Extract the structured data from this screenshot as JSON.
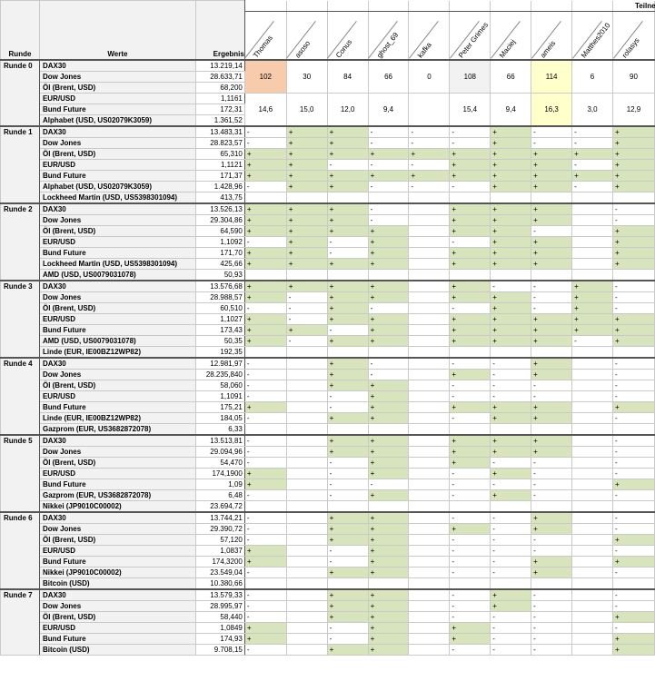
{
  "header": {
    "runde_label": "Runde",
    "werte_label": "Werte",
    "ergebnis_label": "Ergebnis",
    "teilnehmer_label": "Teilne",
    "participants": [
      "Thomas",
      "asoso",
      "Conus",
      "ghost_69",
      "kafka",
      "Peter Grimes",
      "Maciej",
      "ameis",
      "Matthes2010",
      "rolasys"
    ]
  },
  "runde0": {
    "label": "Runde 0",
    "rows": [
      {
        "name": "DAX30",
        "value": "13.219,14"
      },
      {
        "name": "Dow Jones",
        "value": "28.633,71"
      },
      {
        "name": "Öl (Brent, USD)",
        "value": "68,200"
      },
      {
        "name": "EUR/USD",
        "value": "1,1161"
      },
      {
        "name": "Bund Future",
        "value": "172,31"
      },
      {
        "name": "Alphabet (USD, US02079K3059)",
        "value": "1.361,52"
      }
    ],
    "scores": [
      "102",
      "30",
      "84",
      "66",
      "0",
      "108",
      "66",
      "114",
      "6",
      "90"
    ],
    "averages": [
      "14,6",
      "15,0",
      "12,0",
      "9,4",
      "",
      "15,4",
      "9,4",
      "16,3",
      "3,0",
      "12,9"
    ]
  },
  "rounds": [
    {
      "label": "Runde 1",
      "rows": [
        {
          "name": "DAX30",
          "value": "13.483,31",
          "cells": [
            "-",
            "+",
            "+",
            "-",
            "-",
            "-",
            "+",
            "-",
            "-",
            "+"
          ]
        },
        {
          "name": "Dow Jones",
          "value": "28.823,57",
          "cells": [
            "-",
            "+",
            "+",
            "-",
            "-",
            "-",
            "+",
            "-",
            "-",
            "+"
          ]
        },
        {
          "name": "Öl (Brent, USD)",
          "value": "65,310",
          "cells": [
            "+",
            "+",
            "+",
            "+",
            "+",
            "+",
            "+",
            "+",
            "+",
            "+"
          ]
        },
        {
          "name": "EUR/USD",
          "value": "1,1121",
          "cells": [
            "+",
            "+",
            "-",
            "-",
            "-",
            "+",
            "+",
            "+",
            "-",
            "+"
          ]
        },
        {
          "name": "Bund Future",
          "value": "171,37",
          "cells": [
            "+",
            "+",
            "+",
            "+",
            "+",
            "+",
            "+",
            "+",
            "+",
            "+"
          ]
        },
        {
          "name": "Alphabet (USD, US02079K3059)",
          "value": "1.428,96",
          "cells": [
            "-",
            "+",
            "+",
            "-",
            "-",
            "-",
            "+",
            "+",
            "-",
            "+"
          ]
        },
        {
          "name": "Lockheed Martin (USD, US5398301094)",
          "value": "413,75",
          "cells": [
            "",
            "",
            "",
            "",
            "",
            "",
            "",
            "",
            "",
            ""
          ]
        }
      ]
    },
    {
      "label": "Runde 2",
      "rows": [
        {
          "name": "DAX30",
          "value": "13.526,13",
          "cells": [
            "+",
            "+",
            "+",
            "-",
            "",
            "+",
            "+",
            "+",
            "",
            "-"
          ]
        },
        {
          "name": "Dow Jones",
          "value": "29.304,86",
          "cells": [
            "+",
            "+",
            "+",
            "-",
            "",
            "+",
            "+",
            "+",
            "",
            "-"
          ]
        },
        {
          "name": "Öl (Brent, USD)",
          "value": "64,590",
          "cells": [
            "+",
            "+",
            "+",
            "+",
            "",
            "+",
            "+",
            "-",
            "",
            "+"
          ]
        },
        {
          "name": "EUR/USD",
          "value": "1,1092",
          "cells": [
            "-",
            "+",
            "-",
            "+",
            "",
            "-",
            "+",
            "+",
            "",
            "+"
          ]
        },
        {
          "name": "Bund Future",
          "value": "171,70",
          "cells": [
            "+",
            "+",
            "-",
            "+",
            "",
            "+",
            "+",
            "+",
            "",
            "+"
          ]
        },
        {
          "name": "Lockheed Martin (USD, US5398301094)",
          "value": "425,66",
          "cells": [
            "+",
            "+",
            "+",
            "+",
            "",
            "+",
            "+",
            "+",
            "",
            "+"
          ]
        },
        {
          "name": "AMD (USD, US0079031078)",
          "value": "50,93",
          "cells": [
            "",
            "",
            "",
            "",
            "",
            "",
            "",
            "",
            "",
            ""
          ]
        }
      ]
    },
    {
      "label": "Runde 3",
      "rows": [
        {
          "name": "DAX30",
          "value": "13.576,68",
          "cells": [
            "+",
            "+",
            "+",
            "+",
            "",
            "+",
            "-",
            "-",
            "+",
            "-"
          ]
        },
        {
          "name": "Dow Jones",
          "value": "28.988,57",
          "cells": [
            "+",
            "-",
            "+",
            "+",
            "",
            "+",
            "+",
            "-",
            "+",
            "-"
          ]
        },
        {
          "name": "Öl (Brent, USD)",
          "value": "60,510",
          "cells": [
            "-",
            "-",
            "+",
            "-",
            "",
            "-",
            "+",
            "-",
            "+",
            "-"
          ]
        },
        {
          "name": "EUR/USD",
          "value": "1,1027",
          "cells": [
            "+",
            "-",
            "+",
            "+",
            "",
            "+",
            "+",
            "+",
            "+",
            "+"
          ]
        },
        {
          "name": "Bund Future",
          "value": "173,43",
          "cells": [
            "+",
            "+",
            "-",
            "+",
            "",
            "+",
            "+",
            "+",
            "+",
            "+"
          ]
        },
        {
          "name": "AMD (USD, US0079031078)",
          "value": "50,35",
          "cells": [
            "+",
            "-",
            "+",
            "+",
            "",
            "+",
            "+",
            "+",
            "-",
            "+"
          ]
        },
        {
          "name": "Linde (EUR, IE00BZ12WP82)",
          "value": "192,35",
          "cells": [
            "",
            "",
            "",
            "",
            "",
            "",
            "",
            "",
            "",
            ""
          ]
        }
      ]
    },
    {
      "label": "Runde 4",
      "rows": [
        {
          "name": "DAX30",
          "value": "12.981,97",
          "cells": [
            "-",
            "",
            "+",
            "-",
            "",
            "-",
            "-",
            "+",
            "",
            "-"
          ]
        },
        {
          "name": "Dow Jones",
          "value": "28.235,840",
          "cells": [
            "-",
            "",
            "+",
            "-",
            "",
            "+",
            "-",
            "+",
            "",
            "-"
          ]
        },
        {
          "name": "Öl (Brent, USD)",
          "value": "58,060",
          "cells": [
            "-",
            "",
            "+",
            "+",
            "",
            "-",
            "-",
            "-",
            "",
            "-"
          ]
        },
        {
          "name": "EUR/USD",
          "value": "1,1091",
          "cells": [
            "-",
            "",
            "-",
            "+",
            "",
            "-",
            "-",
            "-",
            "",
            "-"
          ]
        },
        {
          "name": "Bund Future",
          "value": "175,21",
          "cells": [
            "+",
            "",
            "-",
            "+",
            "",
            "+",
            "+",
            "+",
            "",
            "+"
          ]
        },
        {
          "name": "Linde (EUR, IE00BZ12WP82)",
          "value": "184,05",
          "cells": [
            "-",
            "",
            "+",
            "+",
            "",
            "-",
            "+",
            "+",
            "",
            "-"
          ]
        },
        {
          "name": "Gazprom (EUR, US3682872078)",
          "value": "6,33",
          "cells": [
            "",
            "",
            "",
            "",
            "",
            "",
            "",
            "",
            "",
            ""
          ]
        }
      ]
    },
    {
      "label": "Runde 5",
      "rows": [
        {
          "name": "DAX30",
          "value": "13.513,81",
          "cells": [
            "-",
            "",
            "+",
            "+",
            "",
            "+",
            "+",
            "+",
            "",
            "-"
          ]
        },
        {
          "name": "Dow Jones",
          "value": "29.094,96",
          "cells": [
            "-",
            "",
            "+",
            "+",
            "",
            "+",
            "+",
            "+",
            "",
            "-"
          ]
        },
        {
          "name": "Öl (Brent, USD)",
          "value": "54,470",
          "cells": [
            "-",
            "",
            "-",
            "+",
            "",
            "+",
            "-",
            "-",
            "",
            "-"
          ]
        },
        {
          "name": "EUR/USD",
          "value": "174,1900",
          "cells": [
            "+",
            "",
            "-",
            "+",
            "",
            "-",
            "+",
            "-",
            "",
            "-"
          ]
        },
        {
          "name": "Bund Future",
          "value": "1,09",
          "cells": [
            "+",
            "",
            "-",
            "-",
            "",
            "-",
            "-",
            "-",
            "",
            "+"
          ]
        },
        {
          "name": "Gazprom (EUR, US3682872078)",
          "value": "6,48",
          "cells": [
            "-",
            "",
            "-",
            "+",
            "",
            "-",
            "+",
            "-",
            "",
            "-"
          ]
        },
        {
          "name": "Nikkei (JP9010C00002)",
          "value": "23.694,72",
          "cells": [
            "",
            "",
            "",
            "",
            "",
            "",
            "",
            "",
            "",
            ""
          ]
        }
      ]
    },
    {
      "label": "Runde 6",
      "rows": [
        {
          "name": "DAX30",
          "value": "13.744,21",
          "cells": [
            "-",
            "",
            "+",
            "+",
            "",
            "-",
            "-",
            "+",
            "",
            "-"
          ]
        },
        {
          "name": "Dow Jones",
          "value": "29.390,72",
          "cells": [
            "-",
            "",
            "+",
            "+",
            "",
            "+",
            "-",
            "+",
            "",
            "-"
          ]
        },
        {
          "name": "Öl (Brent, USD)",
          "value": "57,120",
          "cells": [
            "-",
            "",
            "+",
            "+",
            "",
            "-",
            "-",
            "-",
            "",
            "+"
          ]
        },
        {
          "name": "EUR/USD",
          "value": "1,0837",
          "cells": [
            "+",
            "",
            "-",
            "+",
            "",
            "-",
            "-",
            "-",
            "",
            "-"
          ]
        },
        {
          "name": "Bund Future",
          "value": "174,3200",
          "cells": [
            "+",
            "",
            "-",
            "+",
            "",
            "-",
            "-",
            "+",
            "",
            "+"
          ]
        },
        {
          "name": "Nikkei (JP9010C00002)",
          "value": "23.549,04",
          "cells": [
            "-",
            "",
            "+",
            "+",
            "",
            "-",
            "-",
            "+",
            "",
            "-"
          ]
        },
        {
          "name": "Bitcoin (USD)",
          "value": "10.380,66",
          "cells": [
            "",
            "",
            "",
            "",
            "",
            "",
            "",
            "",
            "",
            ""
          ]
        }
      ]
    },
    {
      "label": "Runde 7",
      "rows": [
        {
          "name": "DAX30",
          "value": "13.579,33",
          "cells": [
            "-",
            "",
            "+",
            "+",
            "",
            "-",
            "+",
            "-",
            "",
            "-"
          ]
        },
        {
          "name": "Dow Jones",
          "value": "28.995,97",
          "cells": [
            "-",
            "",
            "+",
            "+",
            "",
            "-",
            "+",
            "-",
            "",
            "-"
          ]
        },
        {
          "name": "Öl (Brent, USD)",
          "value": "58,440",
          "cells": [
            "-",
            "",
            "+",
            "+",
            "",
            "-",
            "-",
            "-",
            "",
            "+"
          ]
        },
        {
          "name": "EUR/USD",
          "value": "1,0849",
          "cells": [
            "+",
            "",
            "-",
            "+",
            "",
            "+",
            "-",
            "-",
            "",
            "-"
          ]
        },
        {
          "name": "Bund Future",
          "value": "174,93",
          "cells": [
            "+",
            "",
            "-",
            "+",
            "",
            "+",
            "-",
            "-",
            "",
            "+"
          ]
        },
        {
          "name": "Bitcoin (USD)",
          "value": "9.708,15",
          "cells": [
            "-",
            "",
            "+",
            "+",
            "",
            "-",
            "-",
            "-",
            "",
            "+"
          ]
        }
      ]
    }
  ],
  "colors": {
    "green": "#d8e4bc",
    "orange": "#f8cbad",
    "yellow": "#ffffcc",
    "header_gray": "#f2f2f2"
  }
}
